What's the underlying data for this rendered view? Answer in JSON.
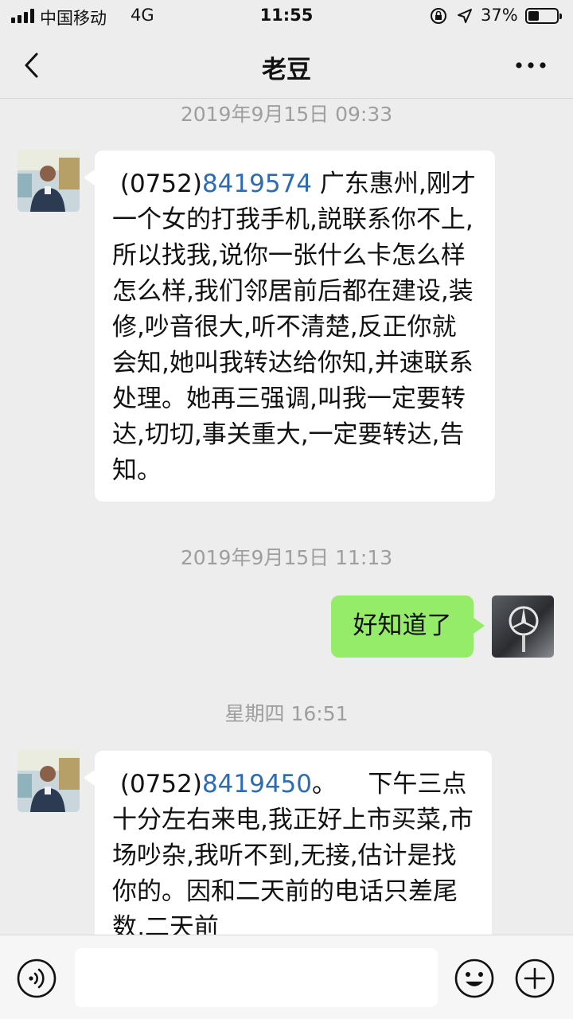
{
  "status_bar": {
    "carrier": "中国移动",
    "network": "4G",
    "time": "11:55",
    "battery_percent": "37%",
    "battery_level": 0.37
  },
  "header": {
    "title": "老豆",
    "back_icon": "chevron-left-icon",
    "more_icon": "more-dots-icon"
  },
  "messages": [
    {
      "timestamp": "2019年9月15日 09:33",
      "from": "received",
      "text_prefix": " (0752)",
      "phone": "8419574",
      "text_suffix": "广东惠州,刚才一个女的打我手机,説联系你不上,所以找我,说你一张什么卡怎么样怎么样,我们邻居前后都在建设,装修,吵音很大,听不清楚,反正你就会知,她叫我转达给你知,并速联系处理。她再三强调,叫我一定要转达,切切,事关重大,一定要转达,告知。"
    },
    {
      "timestamp": "2019年9月15日 11:13",
      "from": "sent",
      "text": "好知道了"
    },
    {
      "timestamp": "星期四 16:51",
      "from": "received",
      "text_prefix": " (0752)",
      "phone": "8419450",
      "text_suffix": "。    下午三点十分左右来电,我正好上市买菜,市场吵杂,我听不到,无接,估计是找你的。因和二天前的电话只差尾数,二天前"
    }
  ],
  "input_bar": {
    "voice_icon": "voice-icon",
    "input_value": "",
    "emoji_icon": "emoji-icon",
    "plus_icon": "plus-icon"
  },
  "colors": {
    "background": "#ededed",
    "sent_bubble": "#95ec69",
    "received_bubble": "#ffffff",
    "link": "#2d6cb5",
    "timestamp": "#9e9e9e"
  }
}
